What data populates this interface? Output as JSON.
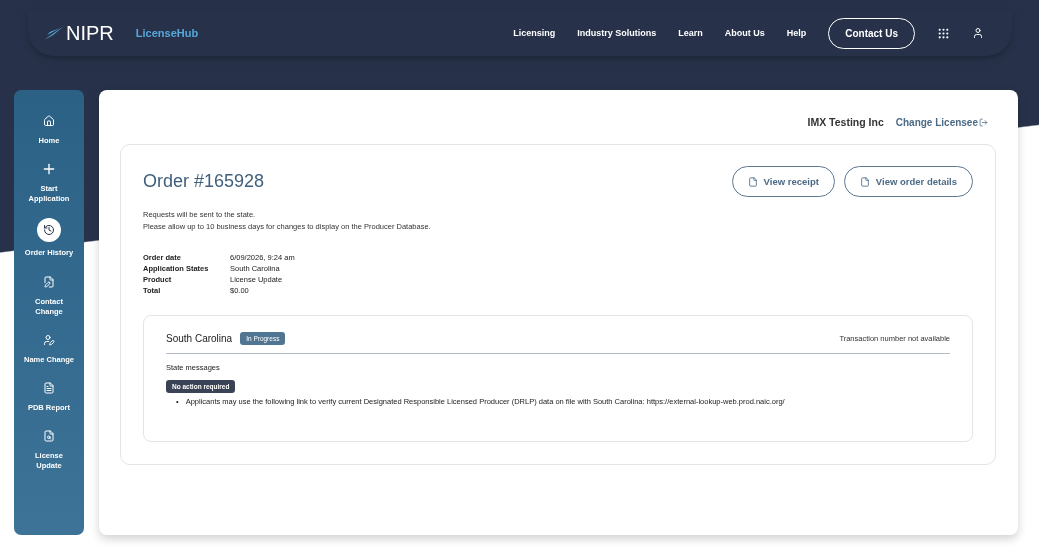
{
  "header": {
    "logo": "NIPR",
    "product": "LicenseHub",
    "nav": [
      "Licensing",
      "Industry Solutions",
      "Learn",
      "About Us",
      "Help"
    ],
    "contact_button": "Contact Us"
  },
  "sidebar": {
    "items": [
      {
        "label": "Home",
        "selected": false
      },
      {
        "label": "Start Application",
        "selected": false
      },
      {
        "label": "Order History",
        "selected": true
      },
      {
        "label": "Contact Change",
        "selected": false
      },
      {
        "label": "Name Change",
        "selected": false
      },
      {
        "label": "PDB Report",
        "selected": false
      },
      {
        "label": "License Update",
        "selected": false
      }
    ]
  },
  "licensee": {
    "name": "IMX Testing Inc",
    "change_link": "Change Licensee"
  },
  "order": {
    "title": "Order #165928",
    "buttons": [
      "View receipt",
      "View order details"
    ],
    "notice": [
      "Requests will be sent to the state.",
      "Please allow up to 10 business days for changes to display on the Producer Database."
    ],
    "details": [
      {
        "label": "Order date",
        "value": "6/09/2026, 9:24 am"
      },
      {
        "label": "Application States",
        "value": "South Carolina"
      },
      {
        "label": "Product",
        "value": "License Update"
      },
      {
        "label": "Total",
        "value": "$0.00"
      }
    ],
    "states": [
      {
        "name": "South Carolina",
        "status": "In Progress",
        "transaction": "Transaction number not available",
        "messages_heading": "State messages",
        "action_badge": "No action required",
        "bullet": "•",
        "messages": [
          "Applicants may use the following link to verify current Designated Responsible Licensed Producer (DRLP) data on file with South Carolina: https://external-lookup-web.prod.naic.org/"
        ]
      }
    ]
  }
}
